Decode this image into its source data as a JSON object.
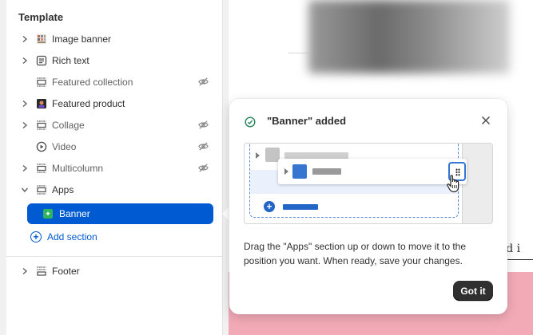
{
  "sidebar": {
    "title": "Template",
    "items": [
      {
        "label": "Image banner",
        "icon": "image-banner-icon",
        "expandable": true,
        "hidden": false
      },
      {
        "label": "Rich text",
        "icon": "text-block-icon",
        "expandable": true,
        "hidden": false
      },
      {
        "label": "Featured collection",
        "icon": "section-icon",
        "expandable": false,
        "hidden": true
      },
      {
        "label": "Featured product",
        "icon": "product-thumbnail-icon",
        "expandable": true,
        "hidden": false
      },
      {
        "label": "Collage",
        "icon": "section-icon",
        "expandable": true,
        "hidden": true
      },
      {
        "label": "Video",
        "icon": "play-icon",
        "expandable": false,
        "hidden": true
      },
      {
        "label": "Multicolumn",
        "icon": "section-icon",
        "expandable": true,
        "hidden": true
      },
      {
        "label": "Apps",
        "icon": "section-icon",
        "expandable": true,
        "expanded": true,
        "hidden": false
      }
    ],
    "selected_block": "Banner",
    "add_section": "Add section",
    "footer": "Footer"
  },
  "popover": {
    "title": "\"Banner\" added",
    "body": "Drag the \"Apps\" section up or down to move it to the position you want. When ready, save your changes.",
    "button": "Got it"
  },
  "preview": {
    "side_text": "ged i"
  },
  "colors": {
    "accent": "#005bd3",
    "success": "#29845a",
    "pink_section": "#f2aab7",
    "button_dark": "#303030"
  }
}
